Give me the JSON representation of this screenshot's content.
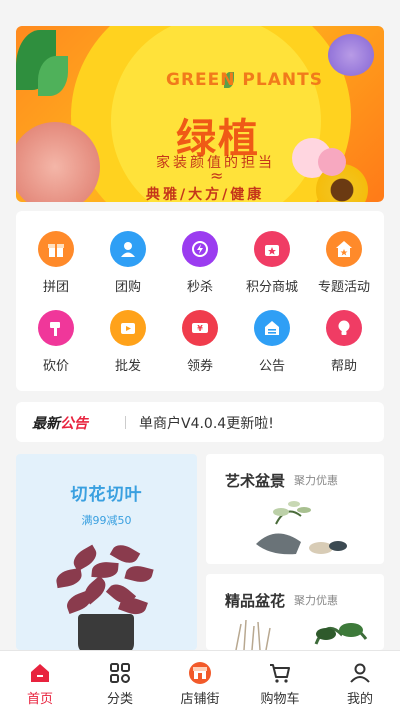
{
  "banner": {
    "title_en": "GREEN PLANTS",
    "title_cn": "绿植",
    "subtitle": "家装颜值的担当",
    "wave": "≈",
    "tagline": "典雅/大方/健康"
  },
  "grid": [
    {
      "label": "拼团",
      "icon": "gift-icon",
      "color": "#ff8a2a"
    },
    {
      "label": "团购",
      "icon": "group-icon",
      "color": "#2f9ff5"
    },
    {
      "label": "秒杀",
      "icon": "flash-clock-icon",
      "color": "#9b3cf0"
    },
    {
      "label": "积分商城",
      "icon": "points-shop-icon",
      "color": "#f03c64"
    },
    {
      "label": "专题活动",
      "icon": "star-house-icon",
      "color": "#ff8a2a"
    },
    {
      "label": "砍价",
      "icon": "hammer-icon",
      "color": "#f0379a"
    },
    {
      "label": "批发",
      "icon": "wholesale-icon",
      "color": "#ffa21a"
    },
    {
      "label": "领券",
      "icon": "coupon-icon",
      "color": "#f03c4c"
    },
    {
      "label": "公告",
      "icon": "notice-icon",
      "color": "#2f9ff5"
    },
    {
      "label": "帮助",
      "icon": "bulb-icon",
      "color": "#f03c64"
    }
  ],
  "notice": {
    "tag_a": "最新",
    "tag_b": "公告",
    "text": "单商户V4.0.4更新啦!"
  },
  "promos": {
    "left": {
      "title": "切花切叶",
      "subtitle": "满99减50"
    },
    "right1": {
      "title": "艺术盆景",
      "subtitle": "聚力优惠"
    },
    "right2": {
      "title": "精品盆花",
      "subtitle": "聚力优惠"
    }
  },
  "tabs": [
    {
      "label": "首页",
      "icon": "home-icon"
    },
    {
      "label": "分类",
      "icon": "grid-icon"
    },
    {
      "label": "店铺街",
      "icon": "store-icon"
    },
    {
      "label": "购物车",
      "icon": "cart-icon"
    },
    {
      "label": "我的",
      "icon": "user-icon"
    }
  ],
  "colors": {
    "accent": "#e8233e",
    "banner": "#ffb21e"
  }
}
